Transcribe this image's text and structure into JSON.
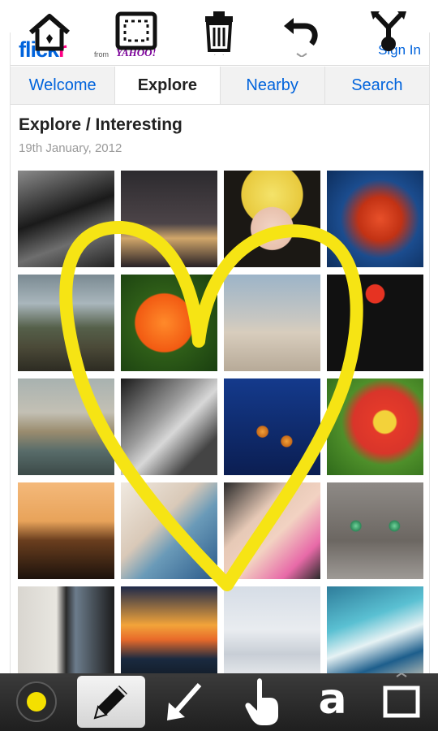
{
  "header": {
    "logo_fl": "flick",
    "logo_r": "r",
    "logo_from": "from",
    "logo_yahoo": "YAHOO!",
    "sign_in": "Sign In"
  },
  "tabs": [
    {
      "label": "Welcome",
      "active": false
    },
    {
      "label": "Explore",
      "active": true
    },
    {
      "label": "Nearby",
      "active": false
    },
    {
      "label": "Search",
      "active": false
    }
  ],
  "content": {
    "heading": "Explore / Interesting",
    "date": "19th January, 2012"
  },
  "top_toolbar": {
    "icons": [
      "home-icon",
      "selection-frame-icon",
      "trash-icon",
      "undo-icon",
      "share-icon"
    ]
  },
  "bottom_toolbar": {
    "color_swatch": "#f4e000",
    "tools": [
      "color-picker",
      "pencil-icon",
      "arrow-icon",
      "hand-pointer-icon",
      "text-tool",
      "rectangle-icon"
    ],
    "text_tool_label": "a",
    "selected_tool": "pencil"
  },
  "drawing": {
    "shape": "heart",
    "stroke_color": "#f6e414"
  },
  "colors": {
    "flickr_blue": "#0063dc",
    "flickr_pink": "#ff0084",
    "yahoo_purple": "#7b0099"
  }
}
